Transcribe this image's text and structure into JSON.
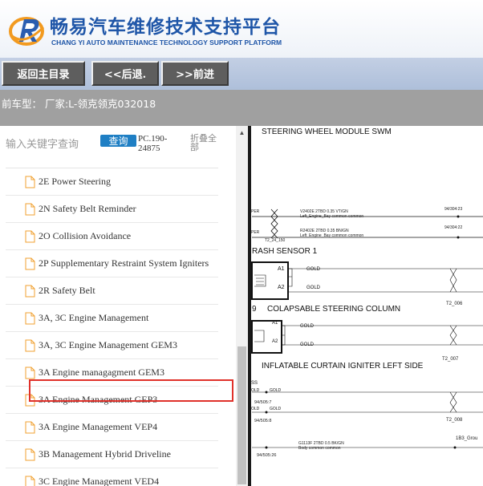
{
  "header": {
    "title_cn": "畅易汽车维修技术支持平台",
    "title_en": "CHANG YI AUTO MAINTENANCE TECHNOLOGY SUPPORT PLATFORM",
    "logo_icon": "r-logo-icon",
    "brand_color": "#1f56a8"
  },
  "nav": {
    "home_label": "返回主目录",
    "back_label": "<<后退.",
    "forward_label": ">>前进"
  },
  "vehicle_bar": {
    "text": "前车型： 厂家:L-领克领克032018"
  },
  "search": {
    "placeholder": "输入关键字查询",
    "button_label": "查询",
    "code": "PC.190-24875",
    "collapse_label": "折叠全部"
  },
  "tree": {
    "items": [
      {
        "label": "2E Power Steering"
      },
      {
        "label": "2N Safety Belt Reminder"
      },
      {
        "label": "2O Collision Avoidance"
      },
      {
        "label": "2P Supplementary Restraint System Igniters"
      },
      {
        "label": "2R Safety Belt"
      },
      {
        "label": "3A, 3C Engine Management"
      },
      {
        "label": "3A, 3C Engine Management GEM3"
      },
      {
        "label": "3A Engine managagment GEM3"
      },
      {
        "label": "3A Engine Management GEP3"
      },
      {
        "label": "3A Engine Management VEP4"
      },
      {
        "label": "3B Management Hybrid Driveline"
      },
      {
        "label": "3C Engine Management VED4"
      }
    ],
    "selected_index": 3,
    "highlight_color": "#e0312a"
  },
  "diagram": {
    "heading1": "STEERING WHEEL MODULE SWM",
    "wire1_pre": "PER",
    "wire1_line1": "V2402E  2TBD 0.35 VT/GN",
    "wire1_line2": "Left_Engine_Bay common  common",
    "wire1_ref": "94/304:23",
    "wire2_pre": "PER",
    "wire2_line1": "R2402E  2TBD 0.35 BN/GN",
    "wire2_line2": "Left_Engine_Bay common  common",
    "wire2_ref": "94/304:22",
    "splice1": "T2_24_150",
    "heading2": "RASH SENSOR 1",
    "a1": "A1",
    "a2": "A2",
    "gold": "GOLD",
    "splice2": "T2_006",
    "heading3_num": "9",
    "heading3": "COLAPSABLE STEERING COLUMN",
    "splice3": "T2_007",
    "heading4": "INFLATABLE CURTAIN IGNITER LEFT SIDE",
    "ss": "SS",
    "old": "OLD",
    "ref7": "94/505:7",
    "ref8": "94/505:8",
    "splice4": "T2_008",
    "wire3_line1": "G1113F  2TBD 0.5 BK/GN",
    "wire3_line2": "Body  common  common",
    "ground_ref": "1B3_Grou",
    "ref26": "94/505:26"
  }
}
